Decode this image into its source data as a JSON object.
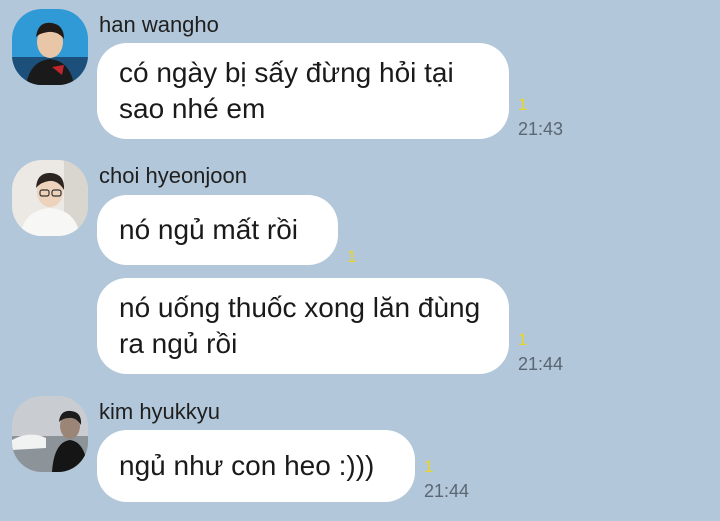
{
  "messages": [
    {
      "sender": "han wangho",
      "avatar_icon": "profile-photo-han-wangho",
      "bubbles": [
        {
          "text": "có ngày bị sấy đừng hỏi tại sao nhé em",
          "unread": "1",
          "time": "21:43"
        }
      ]
    },
    {
      "sender": "choi hyeonjoon",
      "avatar_icon": "profile-photo-choi-hyeonjoon",
      "bubbles": [
        {
          "text": "nó ngủ mất rồi",
          "unread": "1",
          "time": ""
        },
        {
          "text": "nó uống thuốc xong lăn đùng ra ngủ rồi",
          "unread": "1",
          "time": "21:44"
        }
      ]
    },
    {
      "sender": "kim hyukkyu",
      "avatar_icon": "profile-photo-kim-hyukkyu",
      "bubbles": [
        {
          "text": "ngủ như con heo :)))",
          "unread": "1",
          "time": "21:44"
        }
      ]
    }
  ],
  "colors": {
    "background": "#b2c7d9",
    "bubble": "#ffffff",
    "unread": "#e8d52a",
    "time": "#5a6672"
  }
}
